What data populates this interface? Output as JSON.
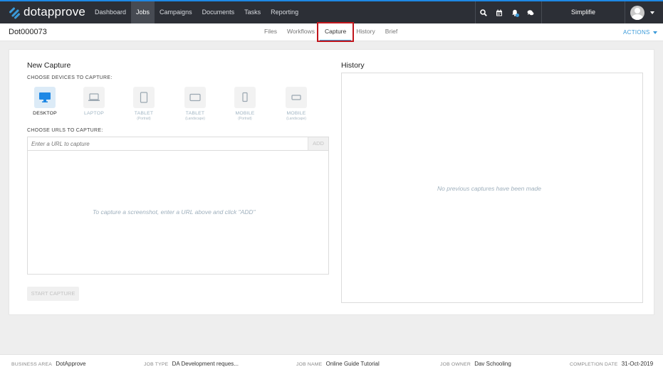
{
  "topnav": {
    "logo_text": "dotapprove",
    "items": [
      {
        "label": "Dashboard",
        "active": false
      },
      {
        "label": "Jobs",
        "active": true
      },
      {
        "label": "Campaigns",
        "active": false
      },
      {
        "label": "Documents",
        "active": false
      },
      {
        "label": "Tasks",
        "active": false
      },
      {
        "label": "Reporting",
        "active": false
      }
    ],
    "icons": [
      "search-icon",
      "calendar-icon",
      "bell-icon",
      "chat-icon"
    ],
    "user_name": "Simplifie"
  },
  "subbar": {
    "job_id": "Dot000073",
    "tabs": [
      {
        "label": "Files",
        "active": false
      },
      {
        "label": "Workflows",
        "active": false
      },
      {
        "label": "Capture",
        "active": true
      },
      {
        "label": "History",
        "active": false
      },
      {
        "label": "Brief",
        "active": false
      }
    ],
    "actions_label": "ACTIONS"
  },
  "capture": {
    "title": "New Capture",
    "devices_label": "CHOOSE DEVICES TO CAPTURE:",
    "devices": [
      {
        "name": "DESKTOP",
        "sub": "",
        "icon": "desktop-icon",
        "active": true
      },
      {
        "name": "LAPTOP",
        "sub": "",
        "icon": "laptop-icon",
        "active": false
      },
      {
        "name": "TABLET",
        "sub": "(Portrait)",
        "icon": "tablet-portrait-icon",
        "active": false
      },
      {
        "name": "TABLET",
        "sub": "(Landscape)",
        "icon": "tablet-landscape-icon",
        "active": false
      },
      {
        "name": "MOBILE",
        "sub": "(Portrait)",
        "icon": "mobile-portrait-icon",
        "active": false
      },
      {
        "name": "MOBILE",
        "sub": "(Landscape)",
        "icon": "mobile-landscape-icon",
        "active": false
      }
    ],
    "urls_label": "CHOOSE URLS TO CAPTURE:",
    "url_placeholder": "Enter a URL to capture",
    "url_value": "",
    "add_label": "ADD",
    "empty_text": "To capture a screenshot, enter a URL above and click \"ADD\"",
    "start_label": "START CAPTURE"
  },
  "history": {
    "title": "History",
    "empty_text": "No previous captures have been made"
  },
  "footer": {
    "business_area_label": "BUSINESS AREA",
    "business_area": "DotApprove",
    "job_type_label": "JOB TYPE",
    "job_type": "DA Development reques...",
    "job_name_label": "JOB NAME",
    "job_name": "Online Guide Tutorial",
    "job_owner_label": "JOB OWNER",
    "job_owner": "Dav Schooling",
    "completion_date_label": "COMPLETION DATE",
    "completion_date": "31-Oct-2019"
  },
  "colors": {
    "accent": "#3a9ad9",
    "nav_bg": "#2c2f36",
    "highlight": "#c0161c"
  }
}
